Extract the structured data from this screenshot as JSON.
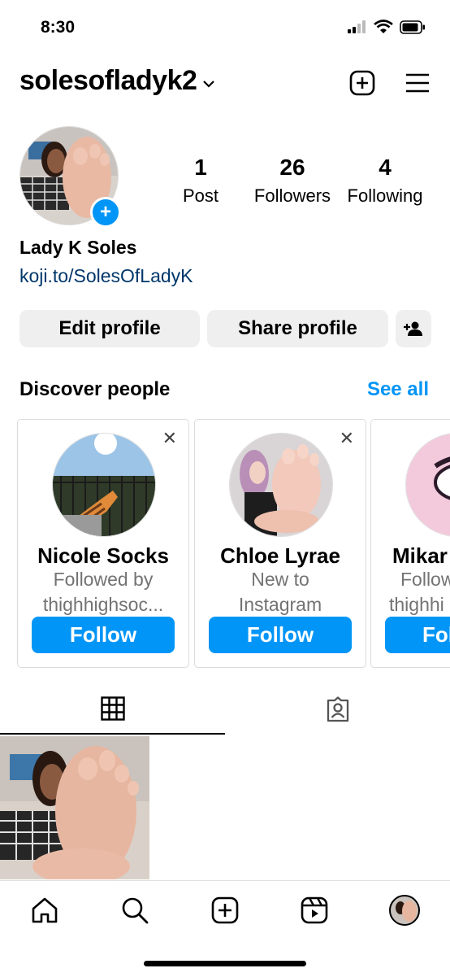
{
  "status_bar": {
    "time": "8:30"
  },
  "header": {
    "username": "solesofladyk2"
  },
  "profile": {
    "stats": [
      {
        "num": "1",
        "label": "Post"
      },
      {
        "num": "26",
        "label": "Followers"
      },
      {
        "num": "4",
        "label": "Following"
      }
    ],
    "full_name": "Lady K Soles",
    "link": "koji.to/SolesOfLadyK",
    "edit_label": "Edit profile",
    "share_label": "Share profile"
  },
  "discover": {
    "title": "Discover people",
    "see_all": "See all",
    "cards": [
      {
        "name": "Nicole Socks",
        "sub1": "Followed by",
        "sub2": "thighhighsoc...",
        "follow": "Follow"
      },
      {
        "name": "Chloe Lyrae",
        "sub1": "New to",
        "sub2": "Instagram",
        "follow": "Follow"
      },
      {
        "name": "Mikar",
        "sub1": "Follow",
        "sub2": "thighhi",
        "follow": "Fol"
      }
    ]
  },
  "colors": {
    "accent": "#0095f6",
    "link": "#00376b",
    "button_bg": "#efefef"
  },
  "icons": [
    "add-post-icon",
    "menu-icon",
    "add-person-icon",
    "grid-icon",
    "tagged-icon",
    "home-icon",
    "search-icon",
    "create-icon",
    "reels-icon",
    "profile-avatar-icon"
  ]
}
